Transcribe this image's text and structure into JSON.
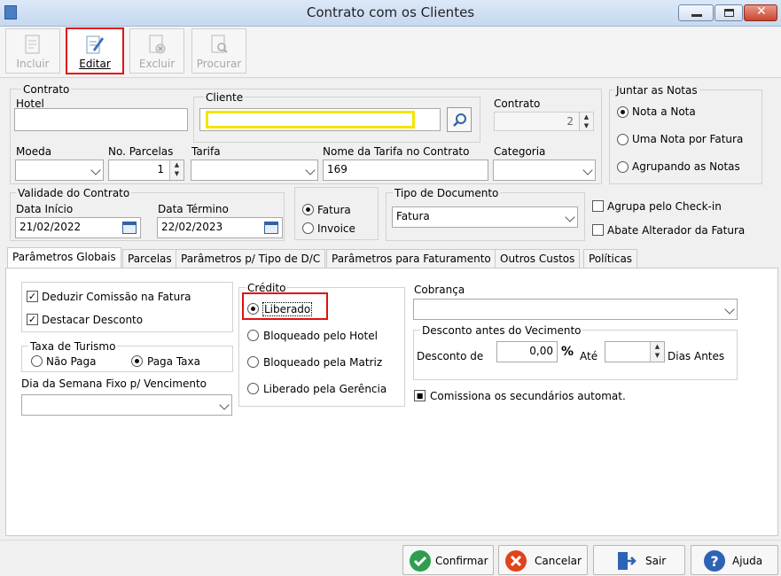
{
  "window": {
    "title": "Contrato com os Clientes"
  },
  "toolbar": {
    "incluir": "Incluir",
    "editar": "Editar",
    "excluir": "Excluir",
    "procurar": "Procurar"
  },
  "contrato": {
    "group_title": "Contrato",
    "hotel_label": "Hotel",
    "hotel_value": "",
    "cliente_label": "Cliente",
    "cliente_value": "",
    "contrato_label": "Contrato",
    "contrato_value": "2",
    "moeda_label": "Moeda",
    "moeda_value": "",
    "parcelas_label": "No. Parcelas",
    "parcelas_value": "1",
    "tarifa_label": "Tarifa",
    "tarifa_value": "",
    "nome_tarifa_label": "Nome da Tarifa no Contrato",
    "nome_tarifa_value": "169",
    "categoria_label": "Categoria",
    "categoria_value": ""
  },
  "juntar": {
    "title": "Juntar as Notas",
    "options": [
      "Nota a Nota",
      "Uma Nota por Fatura",
      "Agrupando as Notas"
    ],
    "selected": "Nota a Nota"
  },
  "validade": {
    "title": "Validade do Contrato",
    "inicio_label": "Data Início",
    "inicio_value": "21/02/2022",
    "termino_label": "Data Término",
    "termino_value": "22/02/2023"
  },
  "fatura_options": {
    "fatura": "Fatura",
    "invoice": "Invoice",
    "selected": "Fatura"
  },
  "tipo_documento": {
    "label": "Tipo de Documento",
    "value": "Fatura"
  },
  "checks_right": {
    "agrupa": "Agrupa pelo Check-in",
    "abate": "Abate Alterador da Fatura"
  },
  "tabs": [
    "Parâmetros Globais",
    "Parcelas",
    "Parâmetros p/ Tipo de D/C",
    "Parâmetros para Faturamento",
    "Outros Custos",
    "Políticas"
  ],
  "global": {
    "deduzir": "Deduzir Comissão na Fatura",
    "destacar": "Destacar Desconto",
    "taxa_title": "Taxa de Turismo",
    "nao_paga": "Não Paga",
    "paga_taxa": "Paga Taxa",
    "dia_label": "Dia da Semana Fixo p/ Vencimento",
    "dia_value": "",
    "credito_title": "Crédito",
    "credito_options": [
      "Liberado",
      "Bloqueado pelo Hotel",
      "Bloqueado pela Matriz",
      "Liberado pela Gerência"
    ],
    "credito_selected": "Liberado",
    "cobranca_label": "Cobrança",
    "cobranca_value": "",
    "desconto_title": "Desconto antes do Vecimento",
    "desconto_de": "Desconto de",
    "desconto_value": "0,00",
    "percent": "%",
    "ate": "Até",
    "ate_value": "",
    "dias_antes": "Dias Antes",
    "comissiona": "Comissiona os secundários automat."
  },
  "buttons": {
    "confirmar": "Confirmar",
    "cancelar": "Cancelar",
    "sair": "Sair",
    "ajuda": "Ajuda"
  },
  "colors": {
    "highlight_red": "#e01010",
    "highlight_yellow": "#f5e400",
    "confirm_green": "#2e9e4e",
    "cancel_red": "#e0441c",
    "help_blue": "#2d63b5"
  }
}
